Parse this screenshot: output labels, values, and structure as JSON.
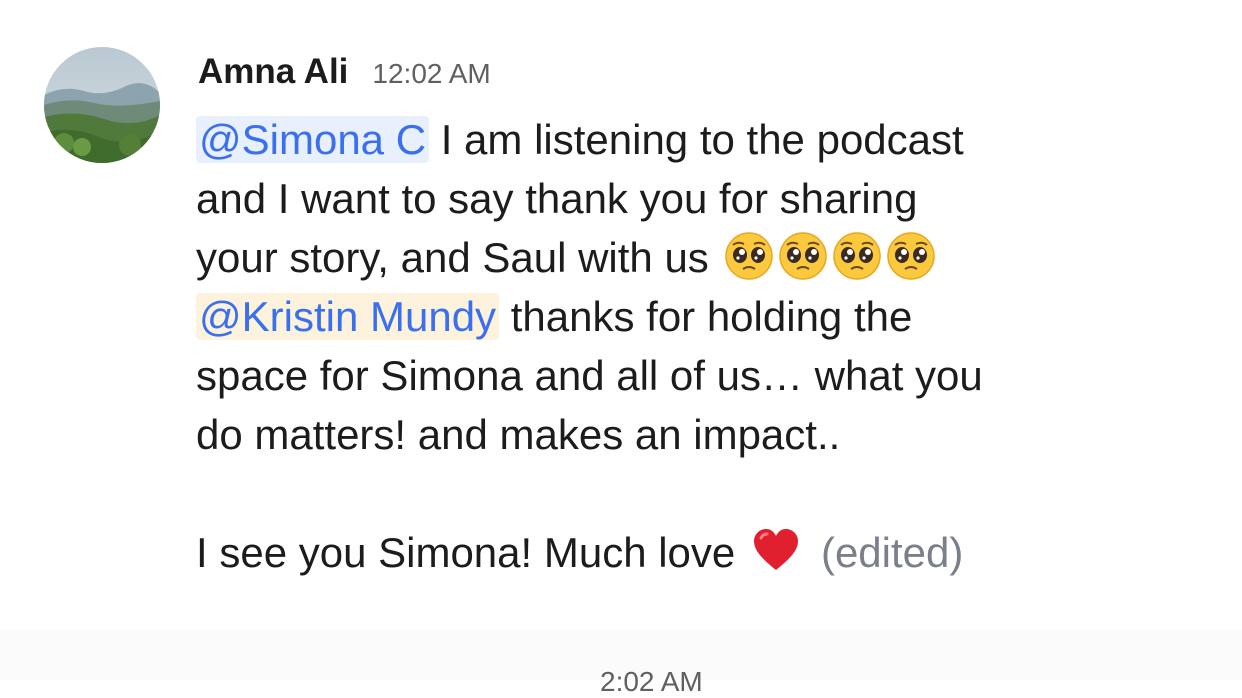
{
  "message": {
    "author": "Amna Ali",
    "timestamp": "12:02 AM",
    "lines": {
      "l1_mention": "@Simona C",
      "l1_text": " I am listening to the podcast",
      "l2_text": "and I want to say thank you for sharing",
      "l3_text": "your story, and Saul with us",
      "l4_mention": "@Kristin Mundy",
      "l4_text": " thanks for holding the",
      "l5_text": "space for Simona and all of us… what you",
      "l6_text": "do matters! and makes an impact..",
      "l8_text": "I see you Simona! Much love ",
      "edited_label": "(edited)"
    },
    "emojis": [
      "pleading-face-emoji",
      "pleading-face-emoji",
      "pleading-face-emoji",
      "pleading-face-emoji",
      "red-heart-emoji"
    ]
  },
  "next_message": {
    "timestamp_partial": "2:02 AM"
  },
  "colors": {
    "mention_text": "#3a6ff0",
    "mention_bg_blue": "#e8f0fd",
    "mention_bg_yellow": "#fdf3dd",
    "timestamp": "#616061",
    "edited": "#7a7f8a"
  }
}
